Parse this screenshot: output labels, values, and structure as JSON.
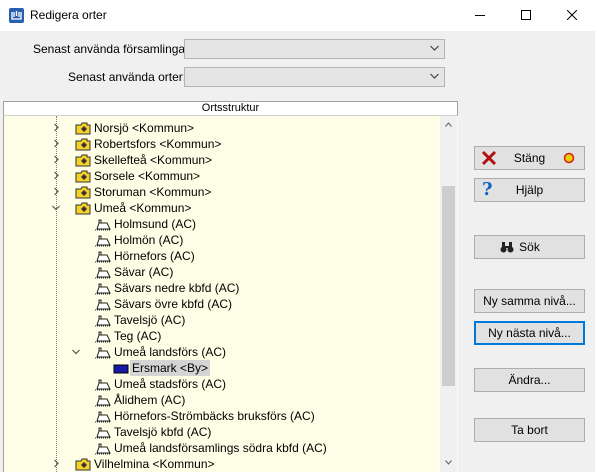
{
  "window": {
    "title": "Redigera orter"
  },
  "fields": {
    "recent_parishes_label": "Senast använda församlingar:",
    "recent_places_label": "Senast använda orter:",
    "recent_parishes_value": "",
    "recent_places_value": ""
  },
  "tree": {
    "header": "Ortsstruktur",
    "items": [
      {
        "label": "Norsjö <Kommun>",
        "level": 1,
        "expander": "collapsed",
        "icon": "folder-icon"
      },
      {
        "label": "Robertsfors <Kommun>",
        "level": 1,
        "expander": "collapsed",
        "icon": "folder-icon"
      },
      {
        "label": "Skellefteå <Kommun>",
        "level": 1,
        "expander": "collapsed",
        "icon": "folder-icon"
      },
      {
        "label": "Sorsele <Kommun>",
        "level": 1,
        "expander": "collapsed",
        "icon": "folder-icon"
      },
      {
        "label": "Storuman <Kommun>",
        "level": 1,
        "expander": "collapsed",
        "icon": "folder-icon"
      },
      {
        "label": "Umeå <Kommun>",
        "level": 1,
        "expander": "expanded",
        "icon": "folder-icon"
      },
      {
        "label": "Holmsund (AC)",
        "level": 2,
        "expander": "none",
        "icon": "church-icon"
      },
      {
        "label": "Holmön (AC)",
        "level": 2,
        "expander": "none",
        "icon": "church-icon"
      },
      {
        "label": "Hörnefors (AC)",
        "level": 2,
        "expander": "none",
        "icon": "church-icon"
      },
      {
        "label": "Sävar (AC)",
        "level": 2,
        "expander": "none",
        "icon": "church-icon"
      },
      {
        "label": "Sävars nedre kbfd (AC)",
        "level": 2,
        "expander": "none",
        "icon": "church-icon"
      },
      {
        "label": "Sävars övre kbfd (AC)",
        "level": 2,
        "expander": "none",
        "icon": "church-icon"
      },
      {
        "label": "Tavelsjö (AC)",
        "level": 2,
        "expander": "none",
        "icon": "church-icon"
      },
      {
        "label": "Teg (AC)",
        "level": 2,
        "expander": "none",
        "icon": "church-icon"
      },
      {
        "label": "Umeå landsförs (AC)",
        "level": 2,
        "expander": "expanded",
        "icon": "church-icon"
      },
      {
        "label": "Ersmark <By>",
        "level": 3,
        "expander": "none",
        "icon": "village-icon",
        "selected": true
      },
      {
        "label": "Umeå stadsförs (AC)",
        "level": 2,
        "expander": "none",
        "icon": "church-icon"
      },
      {
        "label": "Ålidhem (AC)",
        "level": 2,
        "expander": "none",
        "icon": "church-icon"
      },
      {
        "label": "Hörnefors-Strömbäcks bruksförs (AC)",
        "level": 2,
        "expander": "none",
        "icon": "church-icon"
      },
      {
        "label": "Tavelsjö kbfd (AC)",
        "level": 2,
        "expander": "none",
        "icon": "church-icon"
      },
      {
        "label": "Umeå landsförsamlings södra kbfd (AC)",
        "level": 2,
        "expander": "none",
        "icon": "church-icon"
      },
      {
        "label": "Vilhelmina <Kommun>",
        "level": 1,
        "expander": "collapsed",
        "icon": "folder-icon"
      }
    ]
  },
  "buttons": {
    "close": "Stäng",
    "help": "Hjälp",
    "search": "Sök",
    "new_same_level": "Ny samma nivå...",
    "new_next_level": "Ny nästa nivå...",
    "edit": "Ändra...",
    "delete": "Ta bort"
  },
  "colors": {
    "tree_background": "#fefee6",
    "village_icon": "#1a1aa8",
    "focus_border": "#0078d7",
    "close_icon": "#b01010",
    "help_icon": "#1060c0"
  }
}
